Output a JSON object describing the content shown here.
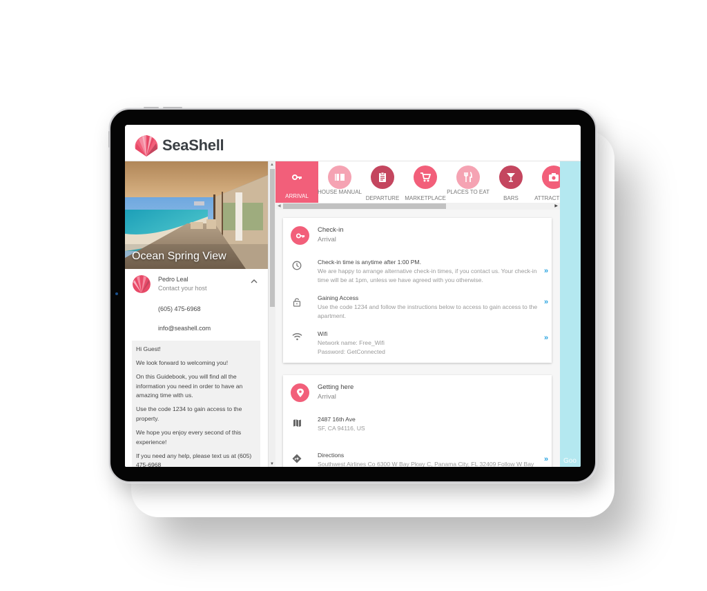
{
  "app": {
    "brand": "SeaShell",
    "brand_color": "#f25f7a"
  },
  "property": {
    "title": "Ocean Spring View"
  },
  "host": {
    "name": "Pedro Leal",
    "subtitle": "Contact your host",
    "phone": "(605) 475-6968",
    "email": "info@seashell.com",
    "toggle_icon": "chevron-up-icon"
  },
  "welcome": {
    "paragraphs": [
      "Hi Guest!",
      "We look forward to welcoming you!",
      "On this Guidebook, you will find all the information you need in order to have an amazing time with us.",
      "Use the code 1234 to gain access to the property.",
      "We hope you enjoy every second of this experience!",
      "If you need any help, please text us at (605) 475-6968"
    ]
  },
  "tabs": [
    {
      "label": "Arrival",
      "icon": "key-icon",
      "active": true,
      "color": "#f25f7a"
    },
    {
      "label": "House Manual",
      "icon": "book-icon",
      "active": false,
      "color": "#f5a3b3"
    },
    {
      "label": "Departure",
      "icon": "clipboard-icon",
      "active": false,
      "color": "#c4465f"
    },
    {
      "label": "Marketplace",
      "icon": "cart-icon",
      "active": false,
      "color": "#f25f7a"
    },
    {
      "label": "Places to Eat",
      "icon": "utensils-icon",
      "active": false,
      "color": "#f5a3b3"
    },
    {
      "label": "Bars",
      "icon": "cocktail-icon",
      "active": false,
      "color": "#c4465f"
    },
    {
      "label": "Attractions",
      "icon": "camera-icon",
      "active": false,
      "color": "#f25f7a"
    }
  ],
  "cards": [
    {
      "title": "Check-in",
      "subtitle": "Arrival",
      "icon": "key-icon",
      "rows": [
        {
          "icon": "clock-icon",
          "title": "Check-in time is anytime after 1:00 PM.",
          "text": "We are happy to arrange alternative check-in times, if you contact us. Your check-in time will be at 1pm, unless we have agreed with you otherwise.",
          "more": "»"
        },
        {
          "icon": "lock-icon",
          "title": "Gaining Access",
          "text": "Use the code 1234 and follow the instructions below to access to gain access to the apartment.",
          "more": "»"
        },
        {
          "icon": "wifi-icon",
          "title": "Wifi",
          "text": "Network name: Free_Wifi\nPassword: GetConnected",
          "lines": [
            "Network name: Free_Wifi",
            "Password: GetConnected"
          ],
          "more": "»"
        }
      ]
    },
    {
      "title": "Getting here",
      "subtitle": "Arrival",
      "icon": "location-pin-icon",
      "rows": [
        {
          "icon": "map-icon",
          "title": "2487 16th Ave",
          "text": "SF, CA 94116, US"
        },
        {
          "icon": "directions-icon",
          "title": "Directions",
          "text": "Southwest Airlines Co 6300 W Bay Pkwy C, Panama City, FL 32409 Follow W Bay",
          "more": "»"
        }
      ]
    }
  ],
  "map": {
    "attribution": "Goo"
  },
  "scroll": {
    "up": "▲",
    "down": "▼",
    "left": "◀",
    "right": "▶"
  }
}
